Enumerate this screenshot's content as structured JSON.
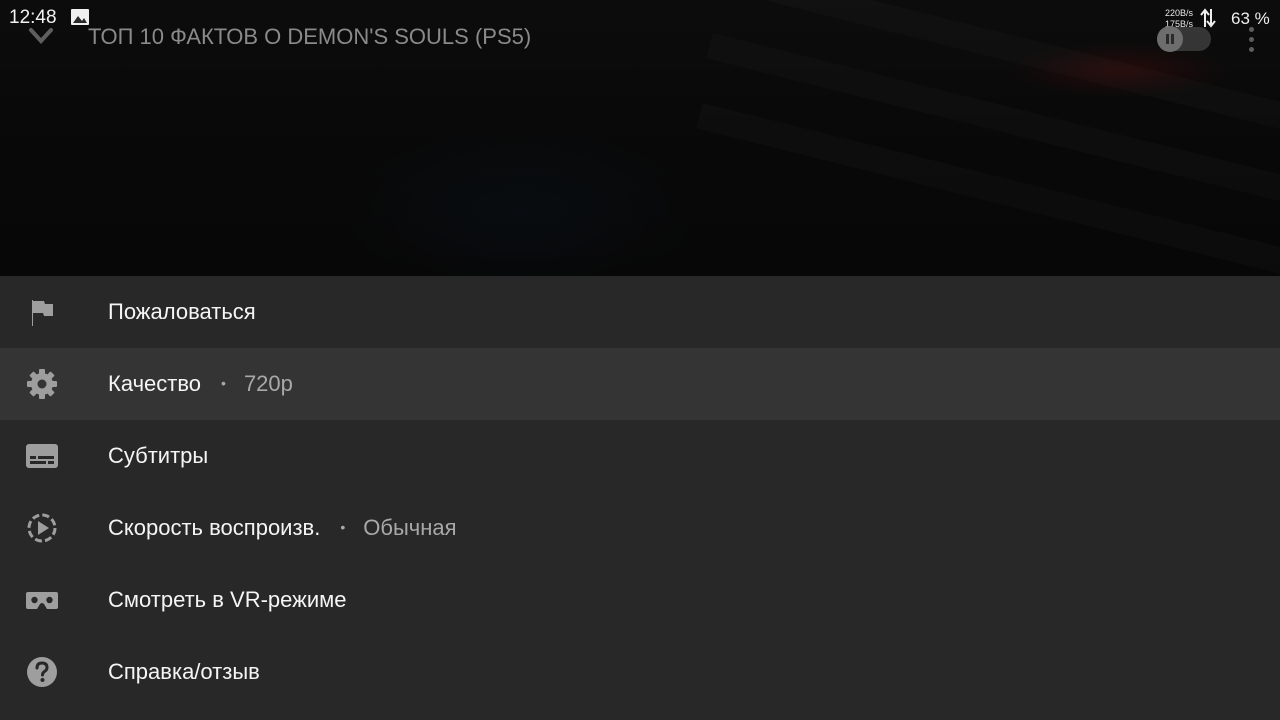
{
  "status_bar": {
    "time": "12:48",
    "net_up": "220B/s",
    "net_down": "175B/s",
    "battery": "63 %"
  },
  "player": {
    "title": "ТОП 10 ФАКТОВ О DEMON'S SOULS (PS5)",
    "autoplay_on": false
  },
  "menu": {
    "items": [
      {
        "label": "Пожаловаться",
        "icon": "flag-icon",
        "value": ""
      },
      {
        "label": "Качество",
        "icon": "gear-icon",
        "value": "720p",
        "separator": "•"
      },
      {
        "label": "Субтитры",
        "icon": "subtitles-icon",
        "value": ""
      },
      {
        "label": "Скорость воспроизв.",
        "icon": "playback-speed-icon",
        "value": "Обычная",
        "separator": "•"
      },
      {
        "label": "Смотреть в VR-режиме",
        "icon": "vr-headset-icon",
        "value": ""
      },
      {
        "label": "Справка/отзыв",
        "icon": "help-icon",
        "value": ""
      }
    ]
  },
  "colors": {
    "menu_background": "#282828",
    "menu_selected": "#343434",
    "icon": "#9e9e9e",
    "text": "#f5f5f5",
    "secondary_text": "#a8a8a8"
  }
}
